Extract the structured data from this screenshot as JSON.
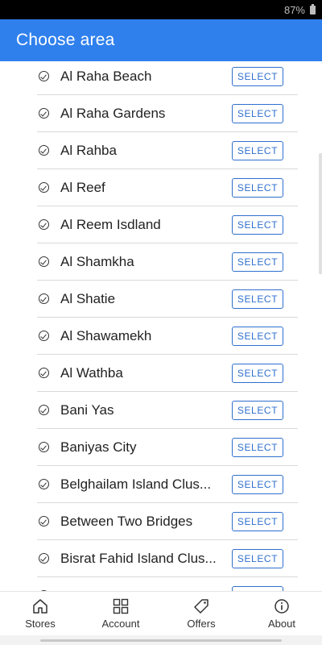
{
  "status_bar": {
    "battery": "87%"
  },
  "app_bar": {
    "title": "Choose area"
  },
  "select_label": "SELECT",
  "areas": [
    "Al Raha Beach",
    "Al Raha Gardens",
    "Al Rahba",
    "Al Reef",
    "Al Reem Isdland",
    "Al Shamkha",
    "Al Shatie",
    "Al Shawamekh",
    "Al Wathba",
    "Bani Yas",
    "Baniyas City",
    "Belghailam Island Clus...",
    "Between Two Bridges",
    "Bisrat Fahid Island Clus...",
    ""
  ],
  "bottom_nav": {
    "stores": "Stores",
    "account": "Account",
    "offers": "Offers",
    "about": "About"
  },
  "colors": {
    "primary": "#2f80ed",
    "button_border": "#2f6fcf"
  }
}
